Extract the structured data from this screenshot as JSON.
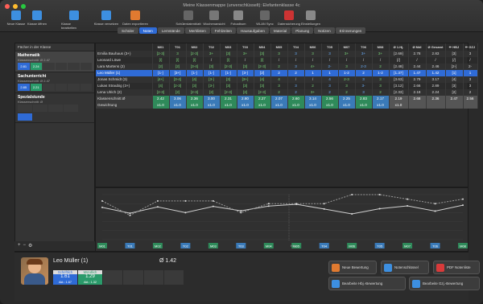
{
  "window": {
    "title": "Meine Klassenmappe (unverschlüsselt): Elefantenklasse 4c"
  },
  "toolbar": {
    "items": [
      {
        "label": "Neue Klasse",
        "icon": "new-class-icon",
        "color": "#3d8fe0"
      },
      {
        "label": "Klasse öffnen",
        "icon": "open-class-icon",
        "color": "#3d8fe0"
      },
      {
        "label": "Klasse bearbeiten",
        "icon": "edit-class-icon",
        "color": "#3d8fe0"
      },
      {
        "label": "Klasse versetzen",
        "icon": "move-class-icon",
        "color": "#3d8fe0"
      },
      {
        "label": "Daten exportieren",
        "icon": "export-icon",
        "color": "#e07a30"
      },
      {
        "label": "Schülerdatenblatt",
        "icon": "datasheet-icon",
        "color": "#666"
      },
      {
        "label": "Wochenansicht",
        "icon": "week-icon",
        "color": "#777"
      },
      {
        "label": "Fotoalbum",
        "icon": "photo-icon",
        "color": "#888"
      },
      {
        "label": "WLAN Sync",
        "icon": "wifi-icon",
        "color": "#666"
      },
      {
        "label": "Datensicherung",
        "icon": "backup-icon",
        "color": "#c33"
      },
      {
        "label": "Einstellungen",
        "icon": "gear-icon",
        "color": "#888"
      }
    ]
  },
  "tabs": [
    "Schüler",
    "Noten",
    "Lernstände",
    "Merklisten",
    "Fehlzeiten",
    "Hausaufgaben",
    "Material",
    "Planung",
    "Notizen",
    "Erinnerungen"
  ],
  "active_tab": "Noten",
  "sidebar": {
    "header": "Fächer in der Klasse",
    "subjects": [
      {
        "name": "Mathematik",
        "sub": "Klassenschnitt: Ø 2.47",
        "labels": [
          "SL",
          "Mdl"
        ],
        "values": [
          "2.81",
          "2.24"
        ],
        "colors": [
          "#2f6bd6",
          "#2a9a6a"
        ]
      },
      {
        "name": "Sachunterricht",
        "sub": "Klassenschnitt: Ø 2.47",
        "labels": [
          "SL",
          "Mdl"
        ],
        "values": [
          "2.85",
          "2.21"
        ],
        "colors": [
          "#2f6bd6",
          "#2a9a6a"
        ]
      },
      {
        "name": "Spezialstunde",
        "sub": "Klassenschnitt: Ø",
        "labels": [],
        "values": [],
        "colors": []
      }
    ],
    "footer": [
      "+",
      "−",
      "⚙"
    ]
  },
  "grid": {
    "headers": [
      "",
      "M01",
      "T01",
      "M02",
      "T02",
      "M03",
      "T03",
      "M04",
      "M05",
      "T04",
      "M06",
      "T05",
      "M07",
      "T06",
      "M08",
      "Ø 1.Hj.",
      "Ø Mdl",
      "Ø Gesamt",
      "✏ HBJ",
      "✏ GZJ"
    ],
    "rows": [
      {
        "name": "Emilia Bauhaus (3+)",
        "cells": [
          "[2-3]",
          "3",
          "[2-3]",
          "3+",
          "[3]",
          "3+",
          "[3]",
          "3",
          "3",
          "3",
          "3",
          "3+",
          "3+",
          "3+",
          "[2.69]",
          "2.78",
          "2.83",
          "[3]",
          "3"
        ]
      },
      {
        "name": "Leonard Löwe",
        "cells": [
          "[/]",
          "[/]",
          "[/]",
          "/",
          "[/]",
          "/",
          "[/]",
          "/",
          "/",
          "/",
          "/",
          "/",
          "/",
          "/",
          "[/]",
          "/",
          "/",
          "[/]",
          "/"
        ]
      },
      {
        "name": "Lara Martens (2)",
        "cells": [
          "[2]",
          "[2]",
          "[3-4]",
          "[3]",
          "[2-3]",
          "[3]",
          "[2-3]",
          "2",
          "3",
          "4+",
          "2-",
          "3",
          "2-3",
          "2",
          "[2.48]",
          "2.44",
          "2.46",
          "[2-]",
          "2-"
        ]
      },
      {
        "name": "Leo Müller (1)",
        "cells": [
          "[1-]",
          "[3+]",
          "[1-]",
          "[1-]",
          "[1-]",
          "[3-]",
          "[2]",
          "2",
          "2",
          "1",
          "1",
          "1-2",
          "2",
          "1-2",
          "[1.37]",
          "1.47",
          "1.42",
          "[1]",
          "1"
        ],
        "selected": true
      },
      {
        "name": "Jonas Schmidt (3)",
        "cells": [
          "[4+]",
          "[3-4]",
          "[4]",
          "[3-]",
          "[3]",
          "[3+]",
          "[4]",
          "4",
          "/",
          "/",
          "4",
          "2-3",
          "3",
          "3",
          "[3.63]",
          "2.79",
          "3.17",
          "[4]",
          "3"
        ]
      },
      {
        "name": "Lukas Straubig (3+)",
        "cells": [
          "[4]",
          "[2-3]",
          "[3]",
          "[3-]",
          "[3]",
          "[3]",
          "[3]",
          "3",
          "3",
          "2",
          "3",
          "3",
          "3-",
          "3",
          "[3.12]",
          "2.66",
          "2.89",
          "[3]",
          "3"
        ]
      },
      {
        "name": "Lena Ulrich (2)",
        "cells": [
          "[2-3]",
          "[2]",
          "[2-3]",
          "[2]",
          "[2-3]",
          "[2]",
          "[2-3]",
          "2",
          "2",
          "3+",
          "2",
          "2",
          "3",
          "2",
          "[2.33]",
          "2.18",
          "2.24",
          "[2]",
          "2"
        ]
      }
    ],
    "avg_label": "Klassenschnitt Ø",
    "avg": [
      "2.42",
      "3.06",
      "2.36",
      "3.00",
      "2.31",
      "2.80",
      "2.27",
      "2.07",
      "2.60",
      "3.14",
      "2.56",
      "2.25",
      "2.83",
      "2.17",
      "2.19",
      "2.68",
      "2.36",
      "2.47",
      "2.56",
      "2.39"
    ],
    "weight_label": "Gewichtung",
    "weight": [
      "x1.0",
      "x1.0",
      "x1.0",
      "x1.0",
      "x1.0",
      "x1.0",
      "x1.0",
      "x1.0",
      "x1.0",
      "x1.0",
      "x1.0",
      "x1.0",
      "x1.0",
      "x1.0",
      "x1.0"
    ]
  },
  "chart_data": {
    "type": "line",
    "categories": [
      "M01",
      "T01",
      "M02",
      "T02",
      "M03",
      "T03",
      "M04",
      "M05",
      "T04",
      "M06",
      "T05",
      "M07",
      "T06",
      "M08"
    ],
    "ylim": [
      1,
      6
    ],
    "series": [
      {
        "values": [
          2.42,
          3.06,
          2.36,
          3.0,
          2.31,
          2.8,
          2.27,
          2.07,
          2.6,
          3.14,
          2.56,
          2.25,
          2.83,
          2.17
        ]
      },
      {
        "values": [
          1.7,
          3.3,
          1.7,
          1.7,
          1.7,
          3.0,
          2.0,
          2.0,
          2.0,
          1.0,
          1.0,
          1.5,
          2.0,
          1.5
        ]
      }
    ],
    "x_marker_label": "Hbj."
  },
  "student": {
    "name": "Leo Müller (1)",
    "avg": "Ø 1.42",
    "grades": [
      {
        "label": "Schriftlich",
        "value": "1.61",
        "sub": "Akt.: 1.67",
        "color": "#2f6bd6"
      },
      {
        "label": "Mündlich",
        "value": "1.29",
        "sub": "Akt.: 1.32",
        "color": "#2a9a6a"
      }
    ]
  },
  "actions": {
    "new_grade": "Neue Bewertung",
    "grade_mirror": "Notenschlüssel",
    "pdf_list": "PDF Notenliste",
    "edit_hbj": "Bearbeite Hbj.-Bewertung",
    "edit_gzj": "Bearbeite Gzj.-Bewertung"
  }
}
